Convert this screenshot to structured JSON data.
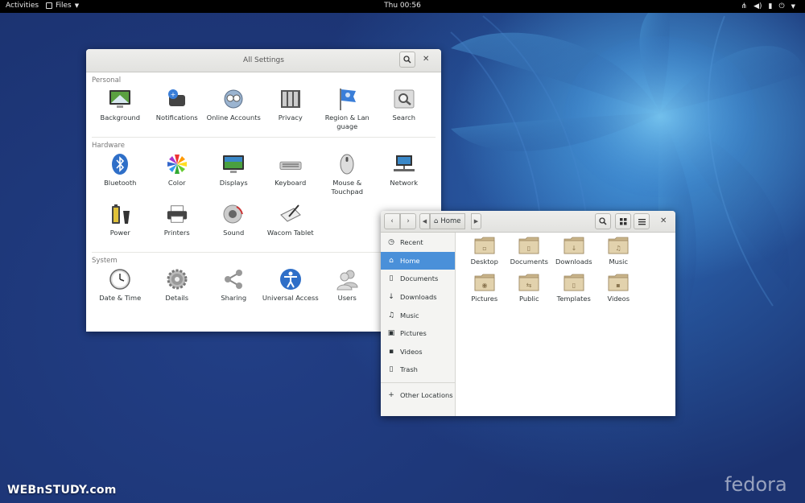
{
  "topbar": {
    "activities": "Activities",
    "app_menu": "Files",
    "clock": "Thu 00:56",
    "icons": [
      "network-icon",
      "volume-icon",
      "battery-icon",
      "power-icon"
    ]
  },
  "settings": {
    "title": "All Settings",
    "sections": [
      {
        "label": "Personal",
        "items": [
          {
            "label": "Background",
            "icon": "background-icon"
          },
          {
            "label": "Notifications",
            "icon": "notifications-icon"
          },
          {
            "label": "Online Accounts",
            "icon": "online-accounts-icon"
          },
          {
            "label": "Privacy",
            "icon": "privacy-icon"
          },
          {
            "label": "Region & Lan guage",
            "icon": "region-language-icon"
          },
          {
            "label": "Search",
            "icon": "search-settings-icon"
          }
        ]
      },
      {
        "label": "Hardware",
        "items": [
          {
            "label": "Bluetooth",
            "icon": "bluetooth-icon"
          },
          {
            "label": "Color",
            "icon": "color-icon"
          },
          {
            "label": "Displays",
            "icon": "displays-icon"
          },
          {
            "label": "Keyboard",
            "icon": "keyboard-icon"
          },
          {
            "label": "Mouse & Touchpad",
            "icon": "mouse-icon"
          },
          {
            "label": "Network",
            "icon": "network-settings-icon"
          },
          {
            "label": "Power",
            "icon": "power-settings-icon"
          },
          {
            "label": "Printers",
            "icon": "printer-icon"
          },
          {
            "label": "Sound",
            "icon": "sound-icon"
          },
          {
            "label": "Wacom Tablet",
            "icon": "wacom-tablet-icon"
          }
        ]
      },
      {
        "label": "System",
        "items": [
          {
            "label": "Date & Time",
            "icon": "clock-icon"
          },
          {
            "label": "Details",
            "icon": "details-gear-icon"
          },
          {
            "label": "Sharing",
            "icon": "sharing-icon"
          },
          {
            "label": "Universal Access",
            "icon": "universal-access-icon"
          },
          {
            "label": "Users",
            "icon": "users-icon"
          }
        ]
      }
    ]
  },
  "files": {
    "breadcrumb": "Home",
    "sidebar": [
      {
        "label": "Recent",
        "icon": "recent-icon",
        "glyph": "◷"
      },
      {
        "label": "Home",
        "icon": "home-icon",
        "glyph": "⌂",
        "active": true
      },
      {
        "label": "Documents",
        "icon": "documents-icon",
        "glyph": "▯"
      },
      {
        "label": "Downloads",
        "icon": "downloads-icon",
        "glyph": "↓"
      },
      {
        "label": "Music",
        "icon": "music-icon",
        "glyph": "♫"
      },
      {
        "label": "Pictures",
        "icon": "pictures-icon",
        "glyph": "▣"
      },
      {
        "label": "Videos",
        "icon": "videos-icon",
        "glyph": "▪"
      },
      {
        "label": "Trash",
        "icon": "trash-icon",
        "glyph": "▯"
      }
    ],
    "other_locations": {
      "label": "Other Locations",
      "glyph": "+"
    },
    "folders": [
      {
        "label": "Desktop",
        "emblem": "▫"
      },
      {
        "label": "Documents",
        "emblem": "▯"
      },
      {
        "label": "Downloads",
        "emblem": "↓"
      },
      {
        "label": "Music",
        "emblem": "♫"
      },
      {
        "label": "Pictures",
        "emblem": "◉"
      },
      {
        "label": "Public",
        "emblem": "⇆"
      },
      {
        "label": "Templates",
        "emblem": "▯"
      },
      {
        "label": "Videos",
        "emblem": "▪"
      }
    ]
  },
  "watermarks": {
    "left": "WEBnSTUDY.com",
    "right": "fedora"
  }
}
